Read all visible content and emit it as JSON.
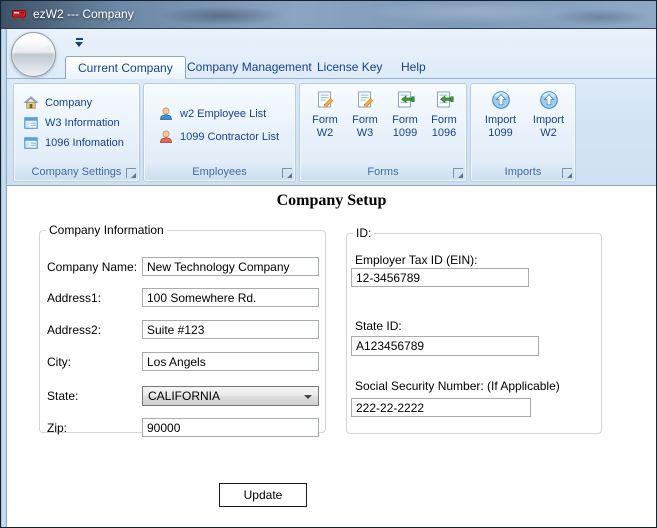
{
  "window": {
    "title": "ezW2 --- Company"
  },
  "tabs": [
    {
      "label": "Current Company",
      "selected": true
    },
    {
      "label": "Company Management",
      "selected": false
    },
    {
      "label": "License Key",
      "selected": false
    },
    {
      "label": "Help",
      "selected": false
    }
  ],
  "ribbon": {
    "company_settings": {
      "caption": "Company Settings",
      "items": [
        {
          "label": "Company"
        },
        {
          "label": "W3 Information"
        },
        {
          "label": "1096 Infomation"
        }
      ]
    },
    "employees": {
      "caption": "Employees",
      "items": [
        {
          "label": "w2 Employee List"
        },
        {
          "label": "1099 Contractor List"
        }
      ]
    },
    "forms": {
      "caption": "Forms",
      "items": [
        {
          "line1": "Form",
          "line2": "W2"
        },
        {
          "line1": "Form",
          "line2": "W3"
        },
        {
          "line1": "Form",
          "line2": "1099"
        },
        {
          "line1": "Form",
          "line2": "1096"
        }
      ]
    },
    "imports": {
      "caption": "Imports",
      "items": [
        {
          "line1": "Import",
          "line2": "1099"
        },
        {
          "line1": "Import",
          "line2": "W2"
        }
      ]
    }
  },
  "main": {
    "heading": "Company Setup",
    "company_info": {
      "legend": "Company Information",
      "fields": [
        {
          "label": "Company Name:",
          "value": "New Technology Company"
        },
        {
          "label": "Address1:",
          "value": "100 Somewhere Rd."
        },
        {
          "label": "Address2:",
          "value": "Suite #123"
        },
        {
          "label": "City:",
          "value": "Los Angels"
        },
        {
          "label": "State:",
          "value": "CALIFORNIA"
        },
        {
          "label": "Zip:",
          "value": "90000"
        }
      ]
    },
    "ids": {
      "legend": "ID:",
      "fields": [
        {
          "label": "Employer Tax ID (EIN):",
          "value": "12-3456789"
        },
        {
          "label": "State ID:",
          "value": "A123456789"
        },
        {
          "label": "Social Security Number: (If Applicable)",
          "value": "222-22-2222"
        }
      ]
    },
    "update_button": "Update"
  },
  "colors": {
    "ribbon_text": "#15428b",
    "group_caption_text": "#3e6e9e",
    "titlebar_base": "#7e9ab9",
    "ribbon_bg": "#d5e5f5"
  }
}
